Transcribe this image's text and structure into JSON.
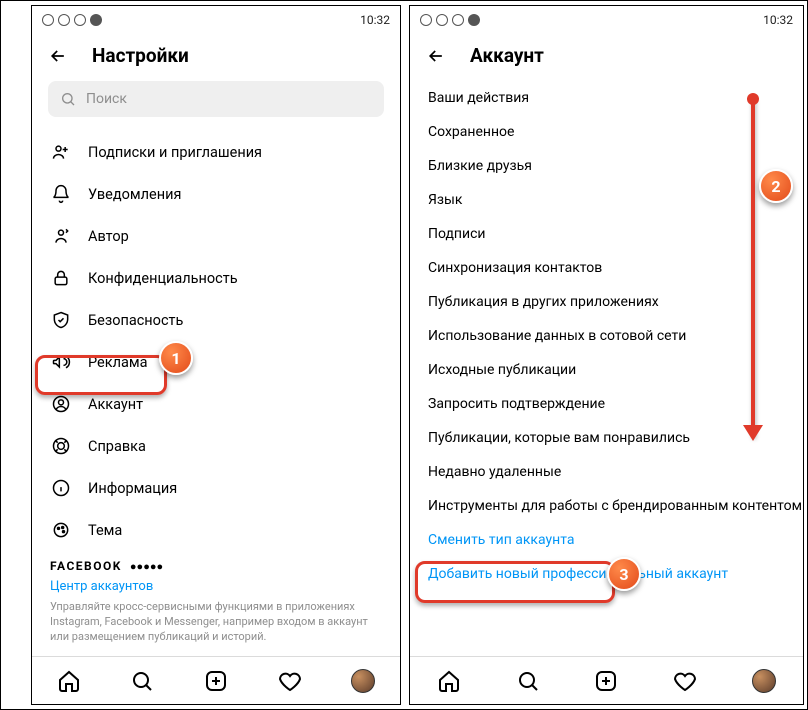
{
  "status": {
    "time": "10:32"
  },
  "left": {
    "title": "Настройки",
    "search_placeholder": "Поиск",
    "items": [
      "Подписки и приглашения",
      "Уведомления",
      "Автор",
      "Конфиденциальность",
      "Безопасность",
      "Реклама",
      "Аккаунт",
      "Справка",
      "Информация",
      "Тема"
    ],
    "facebook_label": "FACEBOOK",
    "accounts_center": "Центр аккаунтов",
    "subtext": "Управляйте кросс-сервисными функциями в приложениях Instagram, Facebook и Messenger, например входом в аккаунт или размещением публикаций и историй."
  },
  "right": {
    "title": "Аккаунт",
    "items": [
      "Ваши действия",
      "Сохраненное",
      "Близкие друзья",
      "Язык",
      "Подписи",
      "Синхронизация контактов",
      "Публикация в других приложениях",
      "Использование данных в сотовой сети",
      "Исходные публикации",
      "Запросить подтверждение",
      "Публикации, которые вам понравились",
      "Недавно удаленные",
      "Инструменты для работы с брендированным контентом"
    ],
    "switch_type": "Сменить тип аккаунта",
    "add_professional": "Добавить новый профессиональный аккаунт"
  },
  "callouts": {
    "one": "1",
    "two": "2",
    "three": "3"
  }
}
